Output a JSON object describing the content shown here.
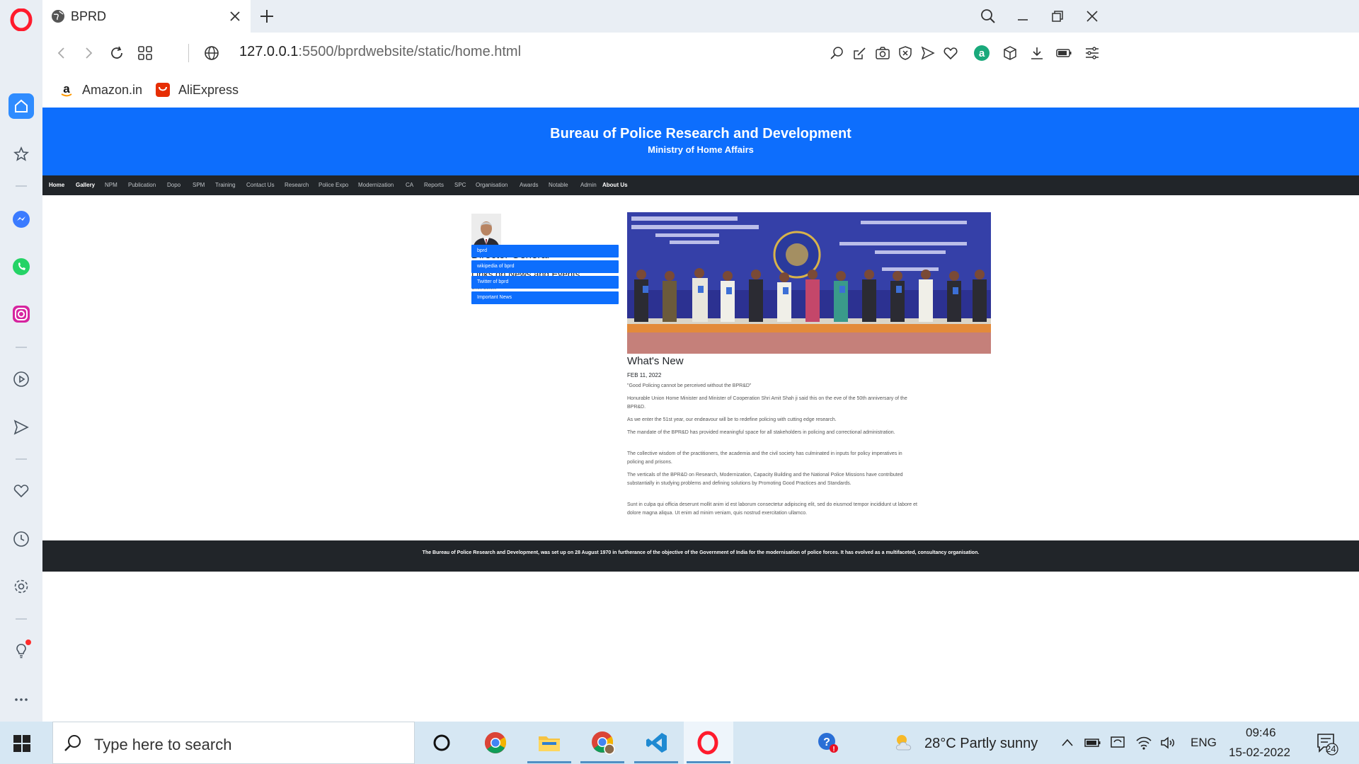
{
  "browser": {
    "tab": {
      "title": "BPRD"
    },
    "url": {
      "host": "127.0.0.1",
      "path": ":5500/bprdwebsite/static/home.html"
    },
    "bookmarks": [
      {
        "label": "Amazon.in",
        "icon": "amazon-icon"
      },
      {
        "label": "AliExpress",
        "icon": "aliexpress-icon"
      }
    ],
    "colors": {
      "accent": "#2f8cff",
      "opera_red": "#ff1b2d",
      "chrome_bg": "#e9eef4"
    }
  },
  "page": {
    "header": {
      "title": "Bureau of Police Research and Development",
      "subtitle": "Ministry of Home Affairs",
      "color": "#0d6efd"
    },
    "nav": [
      {
        "label": "Home",
        "active": true
      },
      {
        "label": "Gallery",
        "active": true
      },
      {
        "label": "NPM"
      },
      {
        "label": "Publication"
      },
      {
        "label": "Dopo"
      },
      {
        "label": "SPM"
      },
      {
        "label": "Training"
      },
      {
        "label": "Contact Us"
      },
      {
        "label": "Research"
      },
      {
        "label": "Police Expo"
      },
      {
        "label": "Modernization"
      },
      {
        "label": "CA"
      },
      {
        "label": "Reports"
      },
      {
        "label": "SPC"
      },
      {
        "label": "Organisation"
      },
      {
        "label": "Awards"
      },
      {
        "label": "Notable"
      },
      {
        "label": "Admin"
      },
      {
        "label": "About Us",
        "active": true
      }
    ],
    "director": {
      "title": "Director General"
    },
    "links": {
      "title": "Links on News and Events",
      "hint": "Click below",
      "items": [
        "bprd",
        "wikipedia of bprd",
        "Twitter of bprd",
        "Important News"
      ]
    },
    "whats_new": {
      "title": "What's New",
      "date": "FEB 11, 2022",
      "paragraphs": [
        "\"Good Policing cannot be perceived without the BPR&D\"",
        "Honurable Union Home Minister and Minister of Cooperation Shri Amit Shah ji said this on the eve of the 50th anniversary of the BPR&D.",
        "As we enter the 51st year, our endeavour will be to redefine policing with cutting edge research.",
        "The mandate of the BPR&D has provided meaningful space for all stakeholders in policing and correctional administration.",
        "The collective wisdom of the practitioners, the academia and the civil society has culminated in inputs for policy imperatives in policing and prisons.",
        "The verticals of the BPR&D on Research, Modernization, Capacity Building and the National Police Missions have contributed substantially in studying problems and defining solutions by Promoting Good Practices and Standards.",
        "Sunt in culpa qui officia deserunt mollit anim id est laborum consectetur adipiscing elit, sed do eiusmod tempor incididunt ut labore et dolore magna aliqua. Ut enim ad minim veniam, quis nostrud exercitation ullamco."
      ]
    },
    "footer": "The Bureau of Police Research and Development, was set up on 28 August 1970 in furtherance of the objective of the Government of India for the modernisation of police forces. It has evolved as a multifaceted, consultancy organisation."
  },
  "taskbar": {
    "search_placeholder": "Type here to search",
    "weather": "28°C  Partly sunny",
    "language": "ENG",
    "time": "09:46",
    "date": "15-02-2022",
    "notifications": "24"
  }
}
